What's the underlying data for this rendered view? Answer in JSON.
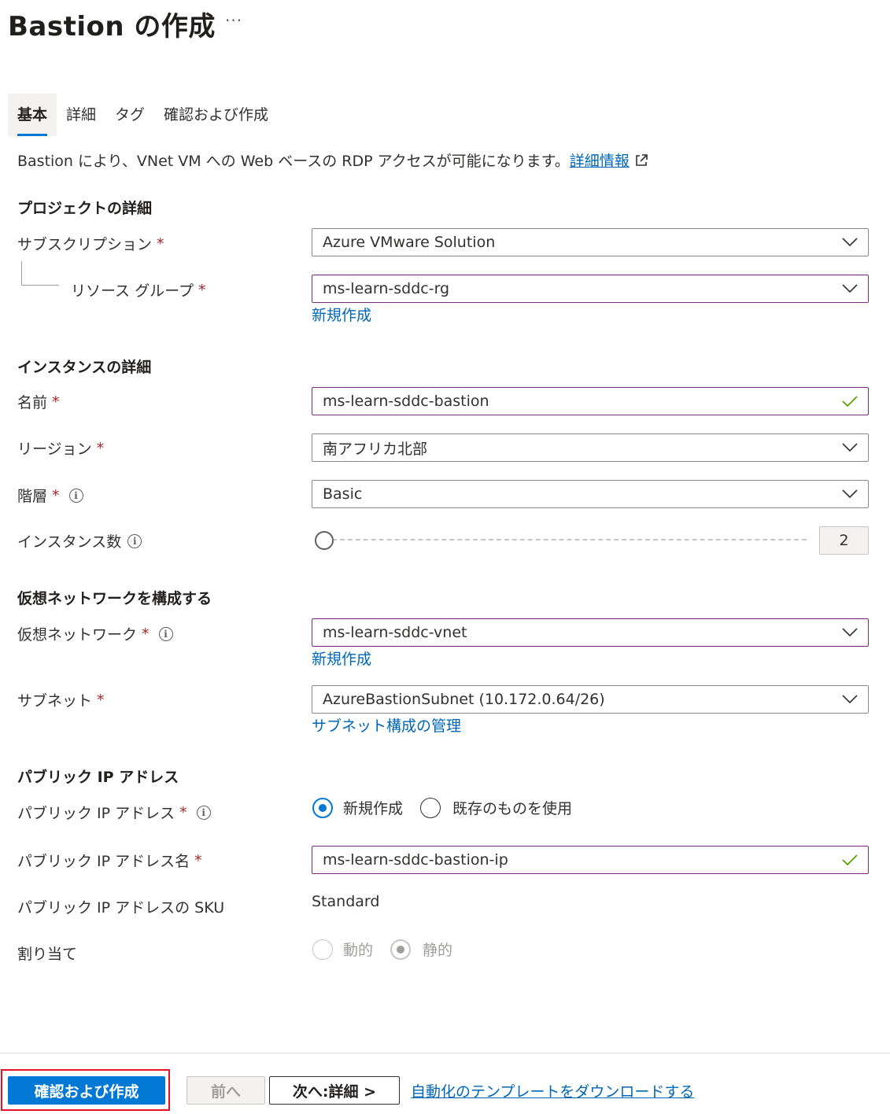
{
  "header": {
    "title": "Bastion の作成",
    "more_label": "···"
  },
  "tabs": [
    {
      "label": "基本",
      "active": true
    },
    {
      "label": "詳細",
      "active": false
    },
    {
      "label": "タグ",
      "active": false
    },
    {
      "label": "確認および作成",
      "active": false
    }
  ],
  "intro": {
    "text": "Bastion により、VNet VM への Web ベースの RDP アクセスが可能になります。",
    "link": "詳細情報"
  },
  "required_mark": "*",
  "project": {
    "heading": "プロジェクトの詳細",
    "subscription": {
      "label": "サブスクリプション",
      "value": "Azure VMware Solution"
    },
    "resource_group": {
      "label": "リソース グループ",
      "value": "ms-learn-sddc-rg",
      "create_new": "新規作成"
    }
  },
  "instance": {
    "heading": "インスタンスの詳細",
    "name": {
      "label": "名前",
      "value": "ms-learn-sddc-bastion"
    },
    "region": {
      "label": "リージョン",
      "value": "南アフリカ北部"
    },
    "tier": {
      "label": "階層",
      "value": "Basic"
    },
    "instance_count": {
      "label": "インスタンス数",
      "value": "2"
    }
  },
  "vnet": {
    "heading": "仮想ネットワークを構成する",
    "network": {
      "label": "仮想ネットワーク",
      "value": "ms-learn-sddc-vnet",
      "create_new": "新規作成"
    },
    "subnet": {
      "label": "サブネット",
      "value": "AzureBastionSubnet (10.172.0.64/26)",
      "manage_link": "サブネット構成の管理"
    }
  },
  "public_ip": {
    "heading": "パブリック IP アドレス",
    "address": {
      "label": "パブリック IP アドレス",
      "option_new": "新規作成",
      "option_existing": "既存のものを使用",
      "selected": "新規作成"
    },
    "name": {
      "label": "パブリック IP アドレス名",
      "value": "ms-learn-sddc-bastion-ip"
    },
    "sku": {
      "label": "パブリック IP アドレスの SKU",
      "value": "Standard"
    },
    "assignment": {
      "label": "割り当て",
      "option_dynamic": "動的",
      "option_static": "静的",
      "selected": "静的"
    }
  },
  "footer": {
    "review_create": "確認および作成",
    "previous": "前へ",
    "next": "次へ:詳細 >",
    "download_template": "自動化のテンプレートをダウンロードする"
  },
  "colors": {
    "accent": "#0078d4",
    "link": "#0067b8",
    "required": "#a4262c",
    "valid": "#57a300",
    "highlight_box": "#e81123"
  }
}
